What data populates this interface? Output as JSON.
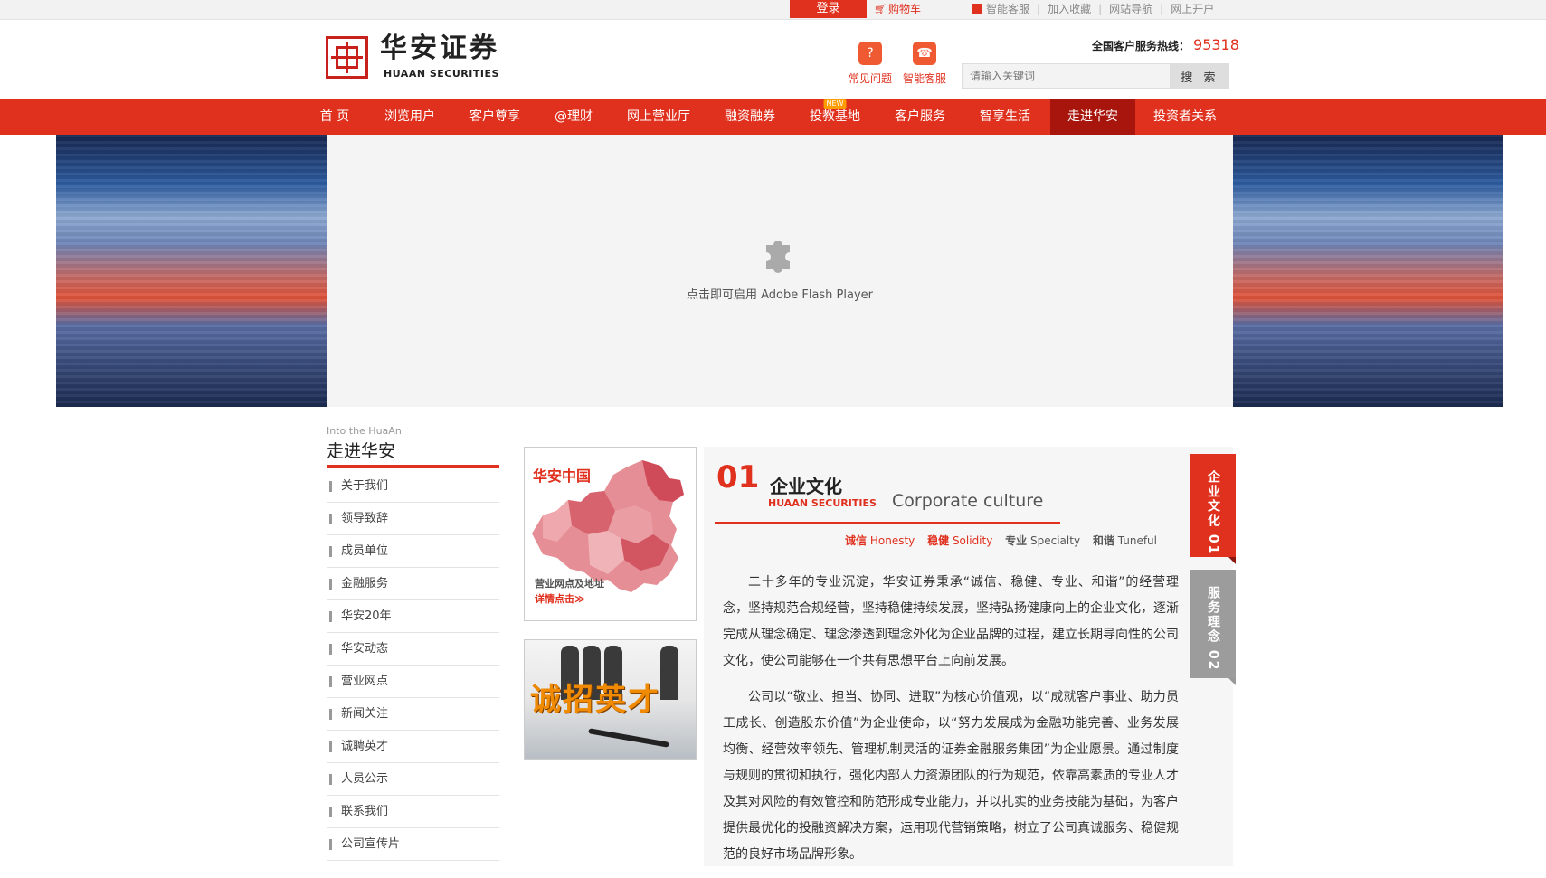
{
  "topbar": {
    "login": "登录",
    "cart": "购物车",
    "links": [
      "智能客服",
      "加入收藏",
      "网站导航",
      "网上开户"
    ]
  },
  "header": {
    "logo_cn": "华安证券",
    "logo_en": "HUAAN SECURITIES",
    "quick": [
      {
        "label": "常见问题",
        "icon": "question-icon"
      },
      {
        "label": "智能客服",
        "icon": "headset-icon"
      }
    ],
    "hotline_label": "全国客户服务热线：",
    "hotline_number": "95318",
    "search_placeholder": "请输入关键词",
    "search_button": "搜 索"
  },
  "nav": {
    "items": [
      "首 页",
      "浏览用户",
      "客户尊享",
      "@理财",
      "网上营业厅",
      "融资融券",
      "投教基地",
      "客户服务",
      "智享生活",
      "走进华安",
      "投资者关系"
    ],
    "new_badge": "NEW",
    "active_index": 9
  },
  "banner": {
    "flash_text": "点击即可启用 Adobe Flash Player"
  },
  "sidebar": {
    "en": "Into the HuaAn",
    "title": "走进华安",
    "items": [
      "关于我们",
      "领导致辞",
      "成员单位",
      "金融服务",
      "华安20年",
      "华安动态",
      "营业网点",
      "新闻关注",
      "诚聘英才",
      "人员公示",
      "联系我们",
      "公司宣传片"
    ]
  },
  "promos": {
    "map_title": "华安中国",
    "map_line1": "营业网点及地址",
    "map_line2": "详情点击≫",
    "talent": "诚招英才"
  },
  "content": {
    "num": "01",
    "title_cn": "企业文化",
    "title_sub": "HUAAN SECURITIES",
    "title_en": "Corporate culture",
    "values": [
      {
        "cn": "诚信",
        "en": "Honesty"
      },
      {
        "cn": "稳健",
        "en": "Solidity"
      },
      {
        "cn": "专业",
        "en": "Specialty"
      },
      {
        "cn": "和谐",
        "en": "Tuneful"
      }
    ],
    "p1": "二十多年的专业沉淀，华安证券秉承“诚信、稳健、专业、和谐”的经营理念，坚持规范合规经营，坚持稳健持续发展，坚持弘扬健康向上的企业文化，逐渐完成从理念确定、理念渗透到理念外化为企业品牌的过程，建立长期导向性的公司文化，使公司能够在一个共有思想平台上向前发展。",
    "p2": "公司以“敬业、担当、协同、进取”为核心价值观，以“成就客户事业、助力员工成长、创造股东价值”为企业使命，以“努力发展成为金融功能完善、业务发展均衡、经营效率领先、管理机制灵活的证券金融服务集团”为企业愿景。通过制度与规则的贯彻和执行，强化内部人力资源团队的行为规范，依靠高素质的专业人才及其对风险的有效管控和防范形成专业能力，并以扎实的业务技能为基础，为客户提供最优化的投融资解决方案，运用现代营销策略，树立了公司真诚服务、稳健规范的良好市场品牌形象。"
  },
  "tabs": {
    "tab1": "企业文化 01",
    "tab2": "服务理念 02"
  },
  "colors": {
    "brand_red": "#e0301e",
    "nav_active": "#a8150c"
  }
}
